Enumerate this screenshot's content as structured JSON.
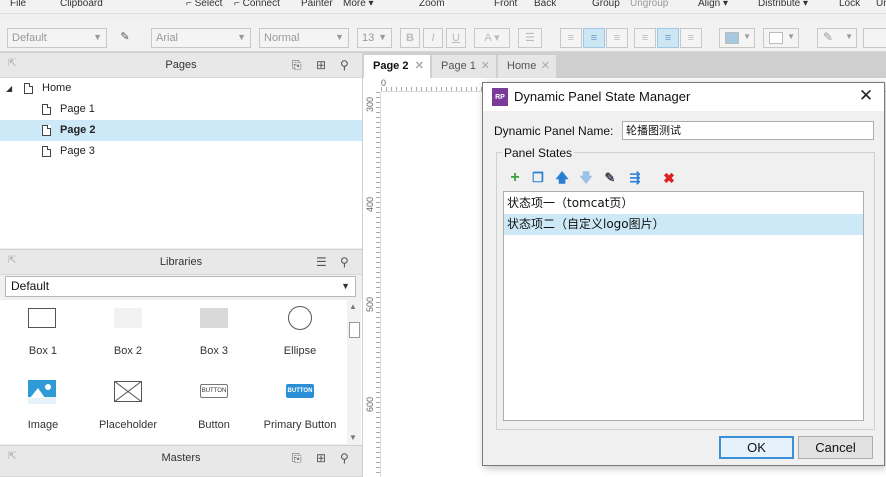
{
  "menubar": {
    "items": [
      "File",
      "Clipboard",
      "Select",
      "Connect",
      "Painter",
      "More ▾",
      "Zoom",
      "Front",
      "Back",
      "Group",
      "Ungroup",
      "Align ▾",
      "Distribute ▾",
      "Lock",
      "Un"
    ]
  },
  "toolbar": {
    "style_value": "Default",
    "font_value": "Arial",
    "weight_value": "Normal",
    "size_value": "13",
    "bold": "B",
    "italic": "I",
    "underline": "U",
    "font_color": "A"
  },
  "pages_panel": {
    "title": "Pages",
    "tree": [
      {
        "label": "Home",
        "level": 0
      },
      {
        "label": "Page 1",
        "level": 1
      },
      {
        "label": "Page 2",
        "level": 1,
        "selected": true
      },
      {
        "label": "Page 3",
        "level": 1
      }
    ]
  },
  "libraries_panel": {
    "title": "Libraries",
    "selected_library": "Default",
    "widgets": [
      "Box 1",
      "Box 2",
      "Box 3",
      "Ellipse",
      "Image",
      "Placeholder",
      "Button",
      "Primary Button"
    ],
    "button_preview": "BUTTON",
    "primary_button_preview": "BUTTON"
  },
  "masters_panel": {
    "title": "Masters"
  },
  "canvas": {
    "tabs": [
      {
        "label": "Page 2",
        "active": true
      },
      {
        "label": "Page 1",
        "active": false
      },
      {
        "label": "Home",
        "active": false
      }
    ],
    "h_ruler_label": "0",
    "v_ruler_labels": [
      "300",
      "400",
      "500",
      "600"
    ]
  },
  "dialog": {
    "app_icon": "RP",
    "title": "Dynamic Panel State Manager",
    "name_label": "Dynamic Panel Name:",
    "name_value": "轮播图测试",
    "states_legend": "Panel States",
    "states": [
      {
        "label": "状态项一（tomcat页）",
        "selected": false
      },
      {
        "label": "状态项二（自定义logo图片）",
        "selected": true
      }
    ],
    "ok_label": "OK",
    "cancel_label": "Cancel"
  },
  "colors": {
    "selection": "#cde8f6",
    "add_icon": "#3aa33a",
    "move_icon": "#2a7fd4",
    "delete_icon": "#e02020",
    "primary_button": "#2a8fd6"
  }
}
